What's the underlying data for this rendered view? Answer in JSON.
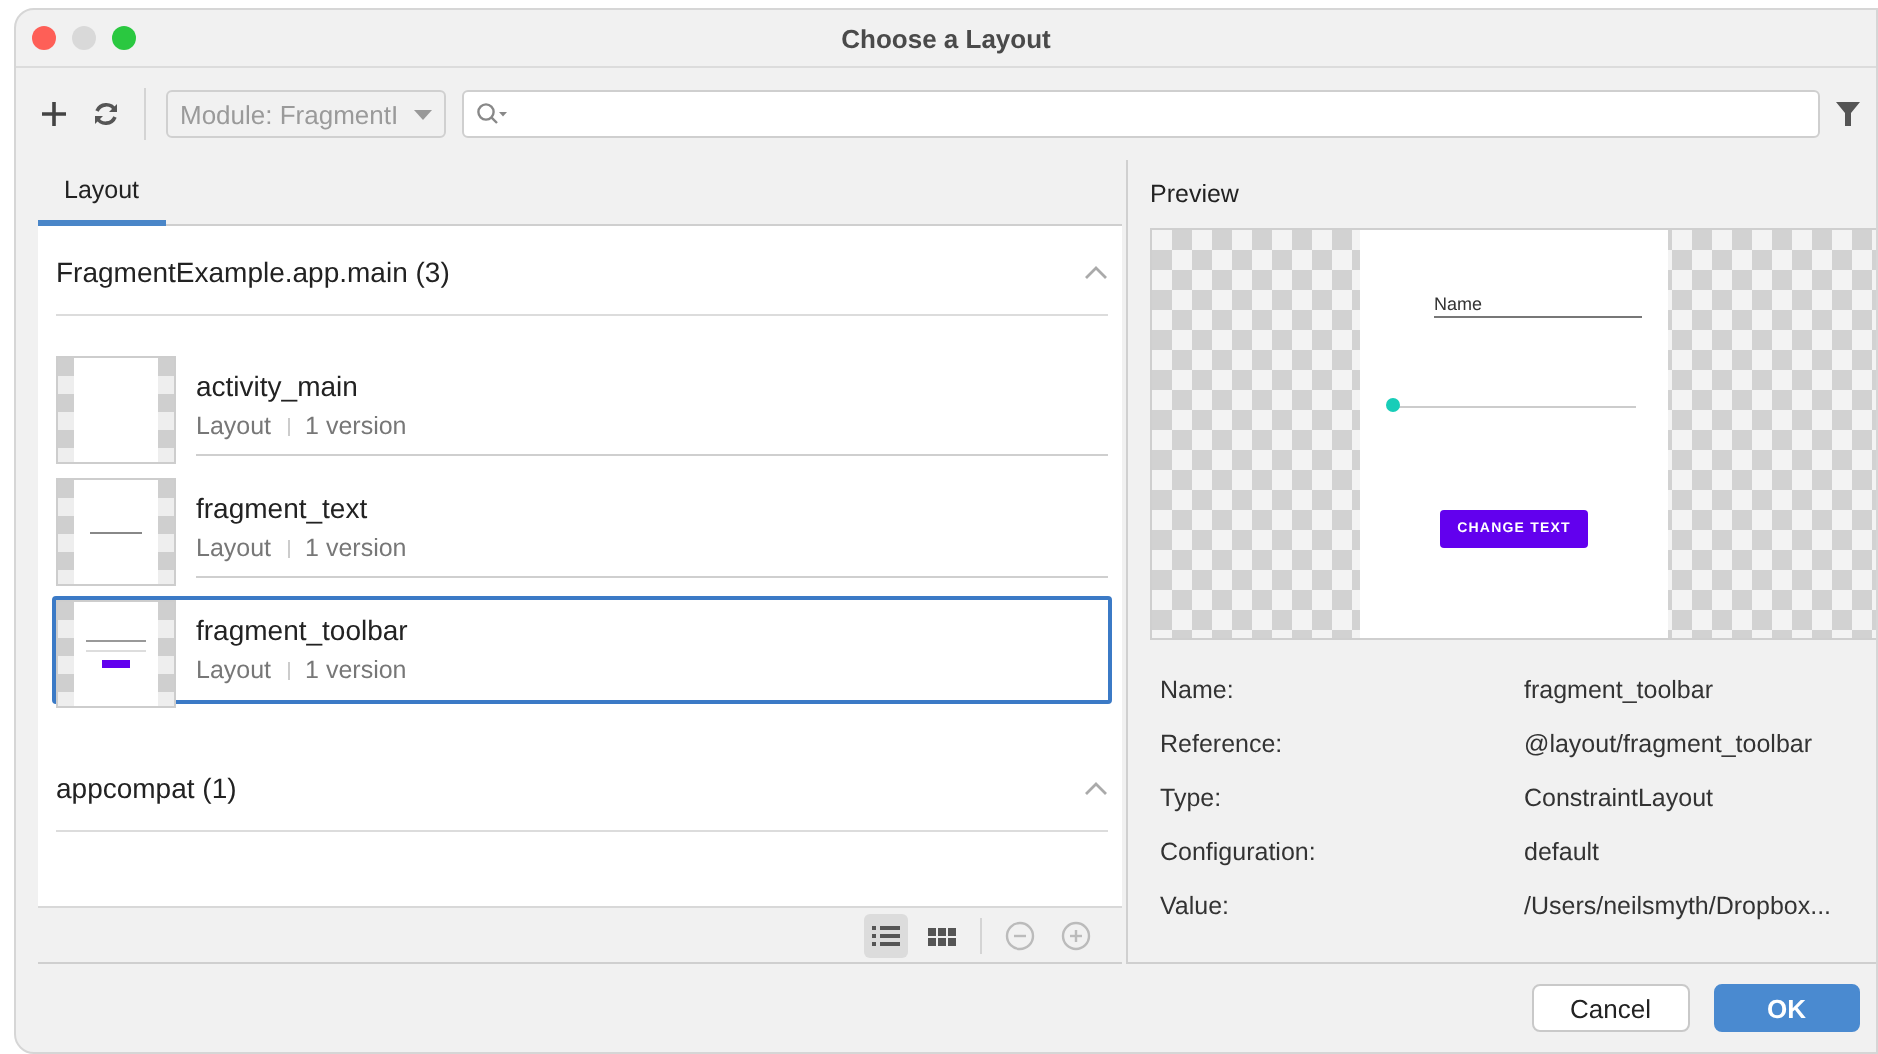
{
  "window": {
    "title": "Choose a Layout"
  },
  "toolbar": {
    "module": {
      "label": "Module: FragmentI",
      "disabled": true
    }
  },
  "tabs": [
    {
      "label": "Layout",
      "selected": true
    }
  ],
  "groups": [
    {
      "title": "FragmentExample.app.main (3)",
      "expanded": true,
      "items": [
        {
          "name": "activity_main",
          "type": "Layout",
          "versions": "1 version",
          "selected": false,
          "kind": "blank"
        },
        {
          "name": "fragment_text",
          "type": "Layout",
          "versions": "1 version",
          "selected": false,
          "kind": "text"
        },
        {
          "name": "fragment_toolbar",
          "type": "Layout",
          "versions": "1 version",
          "selected": true,
          "kind": "form"
        }
      ]
    },
    {
      "title": "appcompat (1)",
      "expanded": true
    }
  ],
  "view_buttons": [
    {
      "kind": "list",
      "selected": true
    },
    {
      "kind": "grid",
      "selected": false
    }
  ],
  "zoom_buttons": [
    {
      "kind": "out",
      "disabled": true
    },
    {
      "kind": "in",
      "disabled": true
    }
  ],
  "preview": {
    "title": "Preview",
    "field_label": "Name",
    "level": 0,
    "button": "CHANGE TEXT"
  },
  "properties": [
    {
      "label": "Name:",
      "value": "fragment_toolbar"
    },
    {
      "label": "Reference:",
      "value": "@layout/fragment_toolbar"
    },
    {
      "label": "Type:",
      "value": "ConstraintLayout"
    },
    {
      "label": "Configuration:",
      "value": "default"
    },
    {
      "label": "Value:",
      "value": "/Users/neilsmyth/Dropbox..."
    }
  ],
  "buttons": [
    {
      "label": "Cancel",
      "kind": "secondary"
    },
    {
      "label": "OK",
      "kind": "primary"
    }
  ]
}
